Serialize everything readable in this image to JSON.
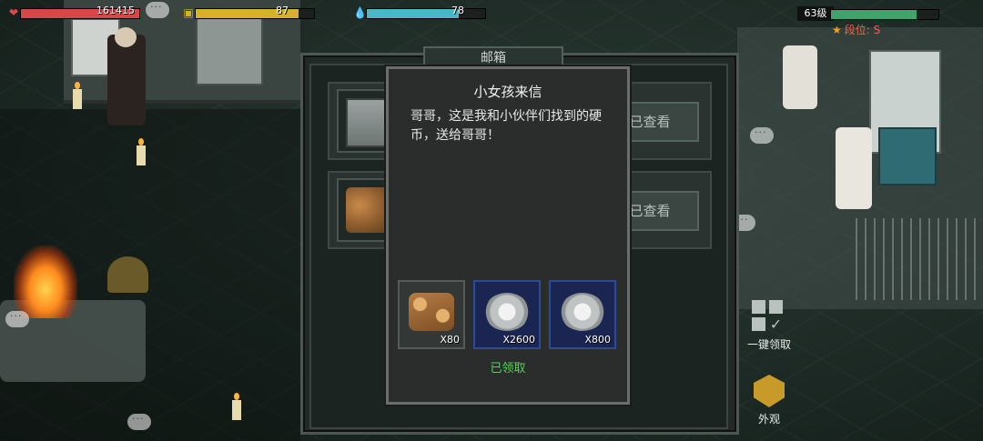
{
  "hud": {
    "hp": {
      "value": "161415",
      "fill_percent": 100,
      "color": "#d64848",
      "icon": "heart-icon"
    },
    "food": {
      "value": "87",
      "fill_percent": 87,
      "color": "#d8b12a",
      "icon": "food-icon"
    },
    "water": {
      "value": "78",
      "fill_percent": 78,
      "color": "#4bb6c8",
      "icon": "water-drop-icon"
    },
    "level": "63级",
    "xp_percent": 80,
    "rank": "段位: S"
  },
  "mailbox": {
    "title": "邮箱",
    "rows": [
      {
        "thumb": "machine-icon",
        "status": "已查看"
      },
      {
        "thumb": "wood-icon",
        "status": "已查看"
      }
    ]
  },
  "letter": {
    "title": "小女孩来信",
    "body": "哥哥，这是我和小伙伴们找到的硬币，送给哥哥！",
    "rewards": [
      {
        "icon": "wood-icon",
        "qty": "X80"
      },
      {
        "icon": "coin-icon",
        "qty": "X2600"
      },
      {
        "icon": "coin-icon",
        "qty": "X800"
      }
    ],
    "claimed_label": "已领取"
  },
  "side": {
    "claim_all_label": "一键领取",
    "appearance_label": "外观"
  }
}
